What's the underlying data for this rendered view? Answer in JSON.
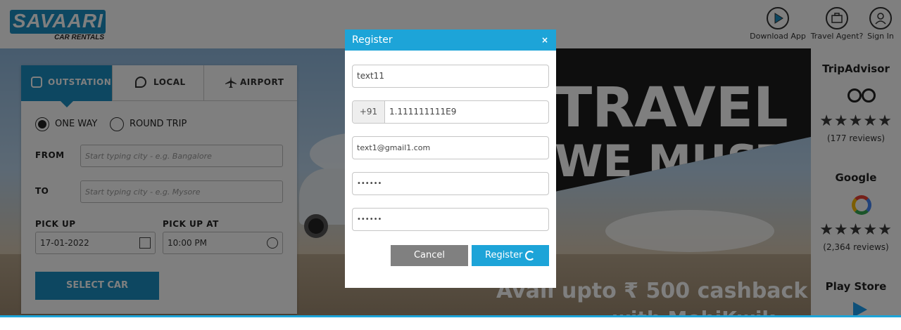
{
  "header": {
    "logo_text": "SAVAARI",
    "logo_sub": "CAR RENTALS",
    "links": [
      {
        "label": "Download App",
        "icon": "play-icon"
      },
      {
        "label": "Travel Agent?",
        "icon": "briefcase-icon"
      },
      {
        "label": "Sign In",
        "icon": "user-icon"
      }
    ]
  },
  "booking": {
    "tabs": [
      {
        "label": "OUTSTATION",
        "icon": "car-icon",
        "active": true
      },
      {
        "label": "LOCAL",
        "icon": "location-pin-icon",
        "active": false
      },
      {
        "label": "AIRPORT",
        "icon": "airplane-icon",
        "active": false
      }
    ],
    "trip_types": [
      {
        "label": "ONE WAY",
        "selected": true
      },
      {
        "label": "ROUND TRIP",
        "selected": false
      }
    ],
    "from": {
      "label": "FROM",
      "placeholder": "Start typing city - e.g. Bangalore"
    },
    "to": {
      "label": "TO",
      "placeholder": "Start typing city - e.g. Mysore"
    },
    "pickup": {
      "label": "PICK UP",
      "value": "17-01-2022"
    },
    "pickup_at": {
      "label": "PICK UP AT",
      "value": "10:00 PM"
    },
    "select_button": "SELECT CAR"
  },
  "banner": {
    "line1": "TRAVEL",
    "line2": "WE MUST",
    "cashback": "Avail upto ₹ 500 cashback",
    "cashback2": "with MobiKwik"
  },
  "sidebar": {
    "tripadvisor": {
      "title": "TripAdvisor",
      "stars": "★★★★★",
      "reviews": "(177 reviews)"
    },
    "google": {
      "title": "Google",
      "stars": "★★★★★",
      "reviews": "(2,364 reviews)"
    },
    "playstore": {
      "title": "Play Store"
    }
  },
  "modal": {
    "title": "Register",
    "close": "×",
    "name_value": "text11",
    "phone_prefix": "+91",
    "phone_value": "1.111111111E9",
    "email_value": "text1@gmail1.com",
    "password_value": "••••••",
    "confirm_password_value": "••••••",
    "cancel_label": "Cancel",
    "register_label": "Register"
  },
  "colors": {
    "accent": "#1da4d8",
    "brand": "#1a8fc3",
    "cancel": "#808080"
  }
}
